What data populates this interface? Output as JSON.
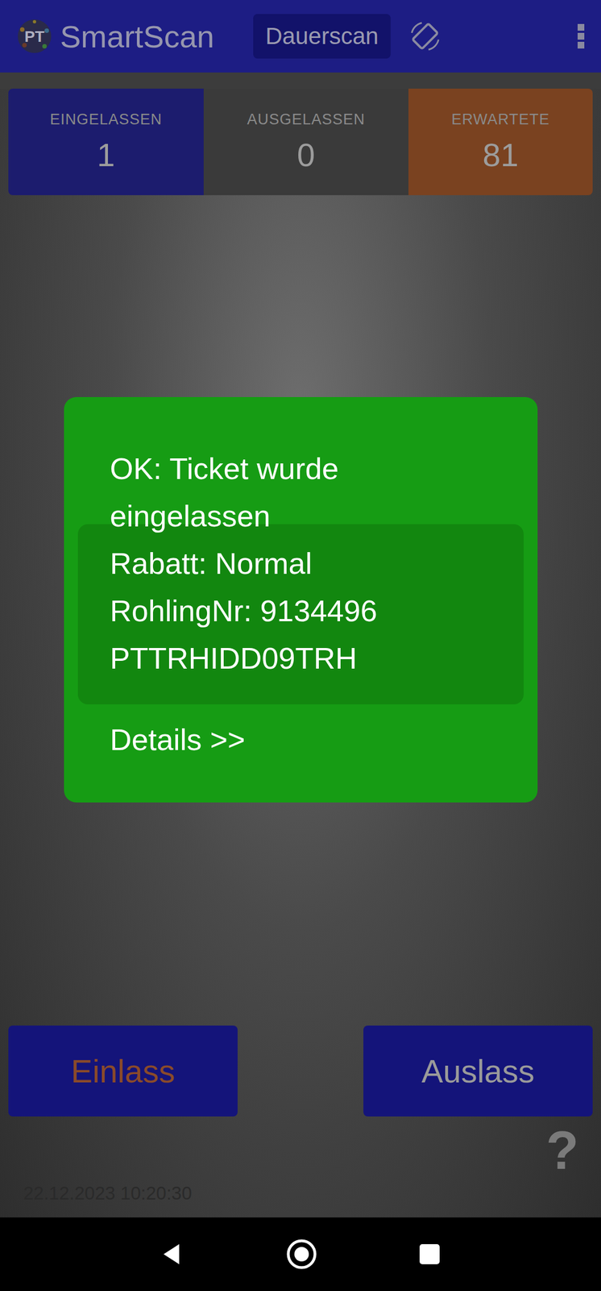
{
  "app": {
    "logo": "PT",
    "title": "SmartScan",
    "mode_button": "Dauerscan"
  },
  "stats": [
    {
      "label": "EINGELASSEN",
      "value": "1",
      "color": "#1c1c6e"
    },
    {
      "label": "AUSGELASSEN",
      "value": "0",
      "color": "#3a3a3a"
    },
    {
      "label": "ERWARTETE",
      "value": "81",
      "color": "#7a4220"
    }
  ],
  "dialog": {
    "status": "ok",
    "lines": [
      "OK: Ticket wurde eingelassen",
      "Rabatt: Normal",
      "RohlingNr: 9134496",
      "PTTRHIDD09TRH"
    ],
    "details_link": "Details >>"
  },
  "actions": [
    {
      "label": "Einlass",
      "selected": true
    },
    {
      "label": "Auslass",
      "selected": false
    }
  ],
  "help": "?",
  "timestamp": "22.12.2023 10:20:30"
}
